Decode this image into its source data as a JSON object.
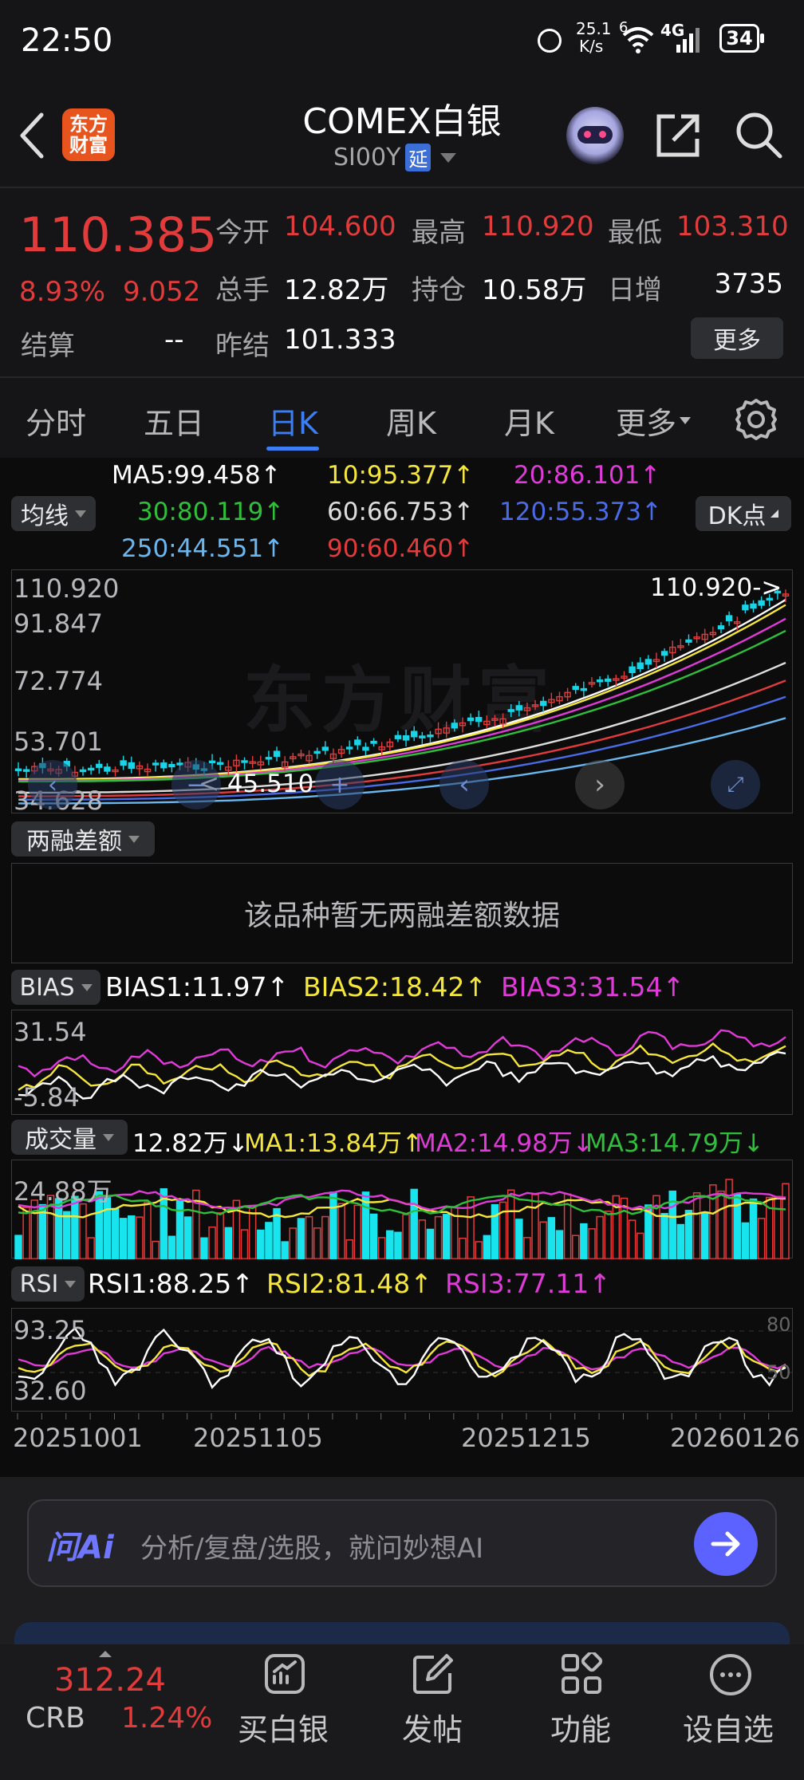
{
  "status": {
    "time": "22:50",
    "speed_value": "25.1",
    "speed_unit": "K/s",
    "wifi_gen": "6",
    "network": "4G",
    "battery": "34"
  },
  "header": {
    "title": "COMEX白银",
    "code": "SI00Y",
    "delay_badge": "延",
    "app_logo_text": "东方财富"
  },
  "quote": {
    "price": "110.385",
    "change_pct": "8.93%",
    "change": "9.052",
    "open_label": "今开",
    "open": "104.600",
    "high_label": "最高",
    "high": "110.920",
    "low_label": "最低",
    "low": "103.310",
    "volume_label": "总手",
    "volume": "12.82万",
    "oi_label": "持仓",
    "oi": "10.58万",
    "inc_label": "日增",
    "inc": "3735",
    "settle_label": "结算",
    "settle": "--",
    "prev_settle_label": "昨结",
    "prev_settle": "101.333",
    "more_label": "更多"
  },
  "tabs": [
    {
      "label": "分时"
    },
    {
      "label": "五日"
    },
    {
      "label": "日K",
      "active": true
    },
    {
      "label": "周K"
    },
    {
      "label": "月K"
    },
    {
      "label": "更多"
    }
  ],
  "ma": {
    "selector": "均线",
    "dk_label": "DK点",
    "items": [
      {
        "text": "MA5:99.458↑",
        "color": "#ffffff"
      },
      {
        "text": "10:95.377↑",
        "color": "#f5e63c"
      },
      {
        "text": "20:86.101↑",
        "color": "#e03ad8"
      },
      {
        "text": "30:80.119↑",
        "color": "#2fbf3a"
      },
      {
        "text": "60:66.753↑",
        "color": "#dddddd"
      },
      {
        "text": "120:55.373↑",
        "color": "#4a6be8"
      },
      {
        "text": "250:44.551↑",
        "color": "#6ab7f0"
      },
      {
        "text": "90:60.460↑",
        "color": "#e23b3b"
      }
    ]
  },
  "kline": {
    "y_labels": [
      "110.920",
      "91.847",
      "72.774",
      "53.701",
      "34.628"
    ],
    "max_marker": "110.920->",
    "min_marker": "< 45.510"
  },
  "margin_panel": {
    "selector": "两融差额",
    "empty_text": "该品种暂无两融差额数据"
  },
  "bias": {
    "selector": "BIAS",
    "values": [
      {
        "text": "BIAS1:11.97↑",
        "color": "#ffffff"
      },
      {
        "text": "BIAS2:18.42↑",
        "color": "#f5e63c"
      },
      {
        "text": "BIAS3:31.54↑",
        "color": "#e03ad8"
      }
    ],
    "y_top": "31.54",
    "y_bottom": "-5.84"
  },
  "volume": {
    "selector": "成交量",
    "values": [
      {
        "text": "12.82万↓",
        "color": "#ffffff"
      },
      {
        "text": "MA1:13.84万↑",
        "color": "#f5e63c"
      },
      {
        "text": "MA2:14.98万↓",
        "color": "#e03ad8"
      },
      {
        "text": "MA3:14.79万↓",
        "color": "#2fbf3a"
      }
    ],
    "y_top": "24.88万"
  },
  "rsi": {
    "selector": "RSI",
    "values": [
      {
        "text": "RSI1:88.25↑",
        "color": "#ffffff"
      },
      {
        "text": "RSI2:81.48↑",
        "color": "#f5e63c"
      },
      {
        "text": "RSI3:77.11↑",
        "color": "#e03ad8"
      }
    ],
    "y_top": "93.25",
    "y_bottom": "32.60",
    "ref_80": "80",
    "ref_50": "50"
  },
  "dates": [
    "20251001",
    "20251105",
    "20251215",
    "20260126"
  ],
  "ai": {
    "logo": "问Ai",
    "placeholder": "分析/复盘/选股，就问妙想AI"
  },
  "bottom": {
    "crb_label": "CRB",
    "crb_value": "312.24",
    "crb_pct": "1.24%",
    "items": [
      {
        "label": "买白银"
      },
      {
        "label": "发帖"
      },
      {
        "label": "功能"
      },
      {
        "label": "设自选"
      }
    ]
  }
}
